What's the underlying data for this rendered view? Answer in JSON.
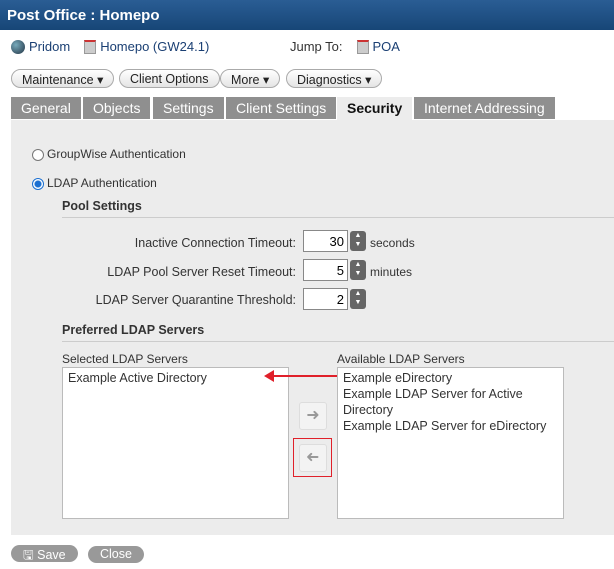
{
  "title": "Post Office : Homepo",
  "breadcrumb": {
    "domain": "Pridom",
    "post_office": "Homepo (GW24.1)",
    "jump_label": "Jump To:",
    "jump_target": "POA"
  },
  "actions": [
    "Maintenance",
    "Client Options",
    "More",
    "Diagnostics"
  ],
  "tabs": [
    "General",
    "Objects",
    "Settings",
    "Client Settings",
    "Security",
    "Internet Addressing"
  ],
  "auth": {
    "groupwise": "GroupWise Authentication",
    "ldap": "LDAP Authentication",
    "selected": "ldap"
  },
  "pool": {
    "heading": "Pool Settings",
    "fields": [
      {
        "label": "Inactive Connection Timeout:",
        "value": "30",
        "unit": "seconds"
      },
      {
        "label": "LDAP Pool Server Reset Timeout:",
        "value": "5",
        "unit": "minutes"
      },
      {
        "label": "LDAP Server Quarantine Threshold:",
        "value": "2",
        "unit": ""
      }
    ]
  },
  "preferred": {
    "heading": "Preferred LDAP Servers",
    "selected_label": "Selected LDAP Servers",
    "available_label": "Available LDAP Servers",
    "selected": [
      "Example Active Directory"
    ],
    "available": [
      "Example eDirectory",
      "Example LDAP Server for Active Directory",
      "Example LDAP Server for eDirectory"
    ]
  },
  "footer": {
    "save": "Save",
    "close": "Close"
  },
  "colors": {
    "annotation": "#e0202a",
    "title_bar": "#1d4f84"
  }
}
